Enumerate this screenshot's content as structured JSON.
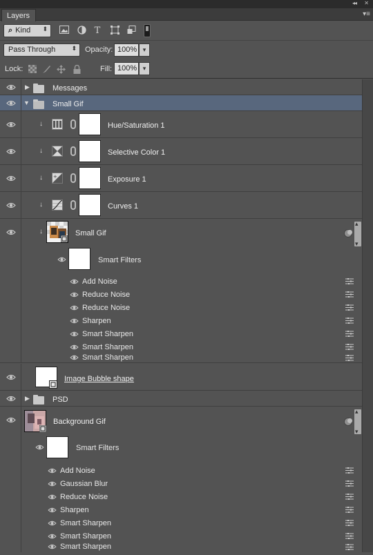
{
  "panel": {
    "tab_label": "Layers",
    "collapse_glyph": "◂◂",
    "close_glyph": "✕",
    "menu_glyph": "▾≡"
  },
  "filter": {
    "kind_symbol": "⌕",
    "kind_label": "Kind",
    "icons": [
      "image-filter-icon",
      "adjustment-filter-icon",
      "type-filter-icon",
      "shape-filter-icon",
      "smart-object-filter-icon"
    ]
  },
  "blend": {
    "mode": "Pass Through",
    "opacity_label": "Opacity:",
    "opacity_value": "100%"
  },
  "lock": {
    "label": "Lock:",
    "fill_label": "Fill:",
    "fill_value": "100%"
  },
  "layers": {
    "messages": "Messages",
    "small_gif_group": "Small Gif",
    "hue_sat": "Hue/Saturation 1",
    "selective_color": "Selective Color 1",
    "exposure": "Exposure 1",
    "curves": "Curves 1",
    "small_gif_so": "Small Gif",
    "smart_filters_1": "Smart Filters",
    "filters_1": [
      "Add Noise",
      "Reduce Noise",
      "Reduce Noise",
      "Sharpen",
      "Smart Sharpen",
      "Smart Sharpen",
      "Smart Sharpen"
    ],
    "image_bubble": "Image Bubble shape",
    "psd": "PSD",
    "background_gif": "Background Gif",
    "smart_filters_2": "Smart Filters",
    "filters_2": [
      "Add Noise",
      "Gaussian Blur",
      "Reduce Noise",
      "Sharpen",
      "Smart Sharpen",
      "Smart Sharpen",
      "Smart Sharpen"
    ]
  },
  "colors": {
    "panel_bg": "#535353",
    "selected_row": "#58677d"
  }
}
